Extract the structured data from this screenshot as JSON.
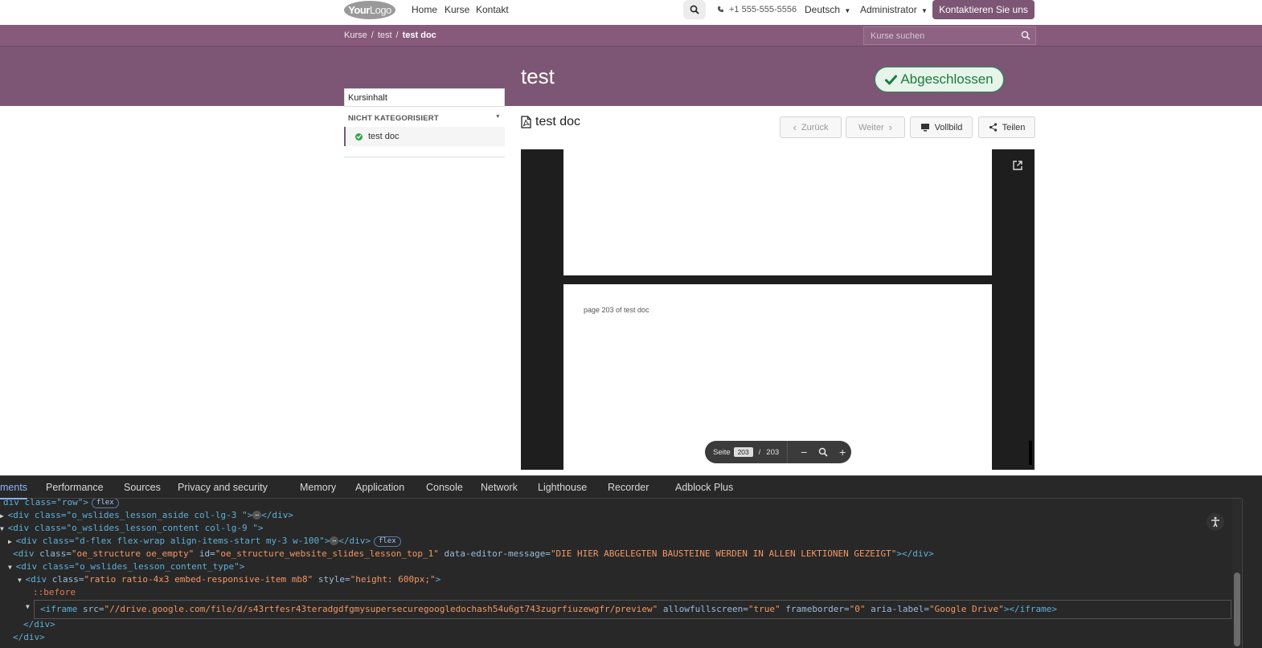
{
  "navbar": {
    "logo_bold": "Your",
    "logo_light": "Logo",
    "links": [
      "Home",
      "Kurse",
      "Kontakt"
    ],
    "phone": "+1 555-555-5556",
    "language": "Deutsch",
    "user": "Administrator",
    "contact_button": "Kontaktieren Sie uns"
  },
  "breadcrumb": {
    "items": [
      "Kurse",
      "test"
    ],
    "current": "test doc",
    "search_placeholder": "Kurse suchen"
  },
  "course": {
    "title": "test",
    "completed_badge": "Abgeschlossen"
  },
  "sidebar": {
    "header": "Kursinhalt",
    "category": "NICHT KATEGORISIERT",
    "lesson": "test doc"
  },
  "lesson": {
    "title": "test doc",
    "prev_label": "Zurück",
    "next_label": "Weiter",
    "fullscreen_label": "Vollbild",
    "share_label": "Teilen"
  },
  "viewer": {
    "page_text": "page 203 of test doc",
    "page_label": "Seite",
    "current_page": "203",
    "page_sep": "/",
    "total_pages": "203"
  },
  "devtools": {
    "tabs": [
      "ments",
      "Performance",
      "Sources",
      "Privacy and security",
      "Memory",
      "Application",
      "Console",
      "Network",
      "Lighthouse",
      "Recorder",
      "Adblock Plus"
    ],
    "badge_flex": "flex",
    "code": {
      "l1_open": "div class=\"row\">",
      "l2": "<div class=\"o_wslides_lesson_aside col-lg-3 \">",
      "l2_close": "</div>",
      "l3": "<div class=\"o_wslides_lesson_content col-lg-9 \">",
      "l4": "<div class=\"d-flex flex-wrap align-items-start my-3 w-100\">",
      "l4_close": "</div>",
      "l5_tag": "<div ",
      "l5_a1": "class=",
      "l5_v1": "\"oe_structure oe_empty\"",
      "l5_a2": " id=",
      "l5_v2": "\"oe_structure_website_slides_lesson_top_1\"",
      "l5_a3": " data-editor-message=",
      "l5_v3": "\"DIE HIER ABGELEGTEN BAUSTEINE WERDEN IN ALLEN LEKTIONEN GEZEIGT\"",
      "l5_end": "></div>",
      "l6": "<div class=\"o_wslides_lesson_content_type\">",
      "l7_tag": "<div ",
      "l7_a1": "class=",
      "l7_v1": "\"ratio ratio-4x3 embed-responsive-item mb8\"",
      "l7_a2": " style=",
      "l7_v2": "\"height: 600px;\"",
      "l7_end": ">",
      "l8": "::before",
      "l9_tag": "<iframe ",
      "l9_a1": "src=",
      "l9_v1": "\"//drive.google.com/file/d/s43rtfesr43teradgdfgmysupersecuregoogledochash54u6gt743zugrfiuzewgfr/preview\"",
      "l9_a2": " allowfullscreen=",
      "l9_v2": "\"true\"",
      "l9_a3": " frameborder=",
      "l9_v3": "\"0\"",
      "l9_a4": " aria-label=",
      "l9_v4": "\"Google Drive\"",
      "l9_end": "></iframe>",
      "l10": "</div>",
      "l11": "</div>"
    }
  },
  "colors": {
    "brand": "#7c5674",
    "breadcrumb_bar": "#875a7b",
    "success": "#28a745"
  }
}
